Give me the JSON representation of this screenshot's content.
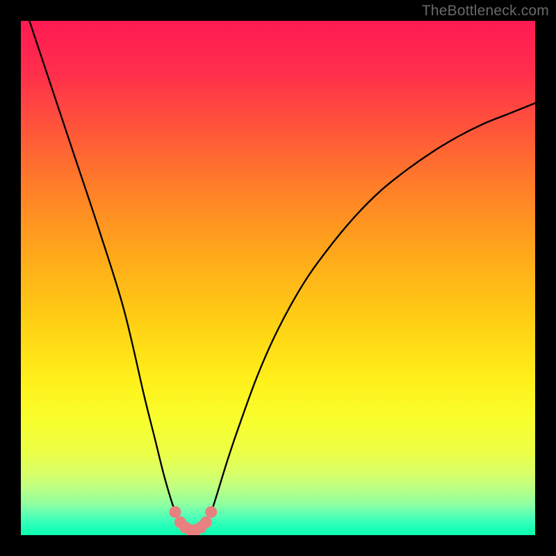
{
  "watermark": "TheBottleneck.com",
  "colors": {
    "background": "#000000",
    "curve": "#000000",
    "marker_fill": "#e88080",
    "marker_stroke": "#d06868"
  },
  "chart_data": {
    "type": "line",
    "title": "",
    "xlabel": "",
    "ylabel": "",
    "xlim": [
      0,
      100
    ],
    "ylim": [
      0,
      100
    ],
    "grid": false,
    "legend": false,
    "series": [
      {
        "name": "bottleneck-curve",
        "x": [
          0,
          5,
          10,
          15,
          20,
          24,
          26,
          28,
          30,
          31,
          32,
          33,
          34,
          35,
          36,
          37,
          38,
          40,
          42,
          46,
          50,
          55,
          60,
          65,
          70,
          75,
          80,
          85,
          90,
          95,
          100
        ],
        "y": [
          105,
          90,
          75,
          60,
          44,
          27,
          19,
          11,
          4.5,
          2.5,
          1.5,
          1.0,
          1.0,
          1.5,
          2.5,
          4.5,
          7.5,
          14,
          20,
          31,
          40,
          49,
          56,
          62,
          67,
          71,
          74.5,
          77.5,
          80,
          82,
          84
        ]
      }
    ],
    "markers": {
      "name": "valley-markers",
      "x": [
        30,
        31,
        32,
        33,
        34,
        35,
        36,
        37
      ],
      "y": [
        4.5,
        2.5,
        1.5,
        1.0,
        1.0,
        1.5,
        2.5,
        4.5
      ]
    }
  }
}
